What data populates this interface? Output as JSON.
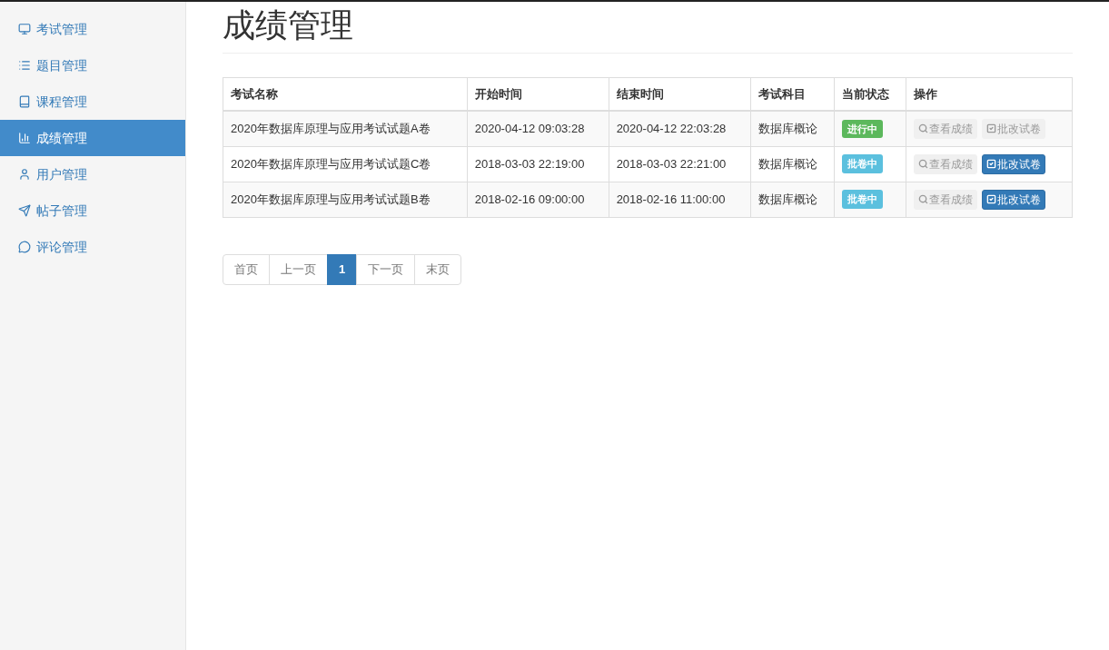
{
  "sidebar": {
    "items": [
      {
        "label": "考试管理",
        "selected": false
      },
      {
        "label": "题目管理",
        "selected": false
      },
      {
        "label": "课程管理",
        "selected": false
      },
      {
        "label": "成绩管理",
        "selected": true
      },
      {
        "label": "用户管理",
        "selected": false
      },
      {
        "label": "帖子管理",
        "selected": false
      },
      {
        "label": "评论管理",
        "selected": false
      }
    ]
  },
  "page_title": "成绩管理",
  "table": {
    "columns": [
      "考试名称",
      "开始时间",
      "结束时间",
      "考试科目",
      "当前状态",
      "操作"
    ],
    "rows": [
      {
        "name": "2020年数据库原理与应用考试试题A卷",
        "start": "2020-04-12 09:03:28",
        "end": "2020-04-12 22:03:28",
        "subject": "数据库概论",
        "status": {
          "label": "进行中",
          "color": "#5cb85c"
        },
        "actions": [
          {
            "label": "查看成绩",
            "kind": "view",
            "disabled": true
          },
          {
            "label": "批改试卷",
            "kind": "grade",
            "disabled": true
          }
        ]
      },
      {
        "name": "2020年数据库原理与应用考试试题C卷",
        "start": "2018-03-03 22:19:00",
        "end": "2018-03-03 22:21:00",
        "subject": "数据库概论",
        "status": {
          "label": "批卷中",
          "color": "#5bc0de"
        },
        "actions": [
          {
            "label": "查看成绩",
            "kind": "view",
            "disabled": true
          },
          {
            "label": "批改试卷",
            "kind": "grade",
            "disabled": false
          }
        ]
      },
      {
        "name": "2020年数据库原理与应用考试试题B卷",
        "start": "2018-02-16 09:00:00",
        "end": "2018-02-16 11:00:00",
        "subject": "数据库概论",
        "status": {
          "label": "批卷中",
          "color": "#5bc0de"
        },
        "actions": [
          {
            "label": "查看成绩",
            "kind": "view",
            "disabled": true
          },
          {
            "label": "批改试卷",
            "kind": "grade",
            "disabled": false
          }
        ]
      }
    ]
  },
  "pagination": [
    {
      "label": "首页",
      "selected": false
    },
    {
      "label": "上一页",
      "selected": false
    },
    {
      "label": "1",
      "selected": true
    },
    {
      "label": "下一页",
      "selected": false
    },
    {
      "label": "末页",
      "selected": false
    }
  ]
}
